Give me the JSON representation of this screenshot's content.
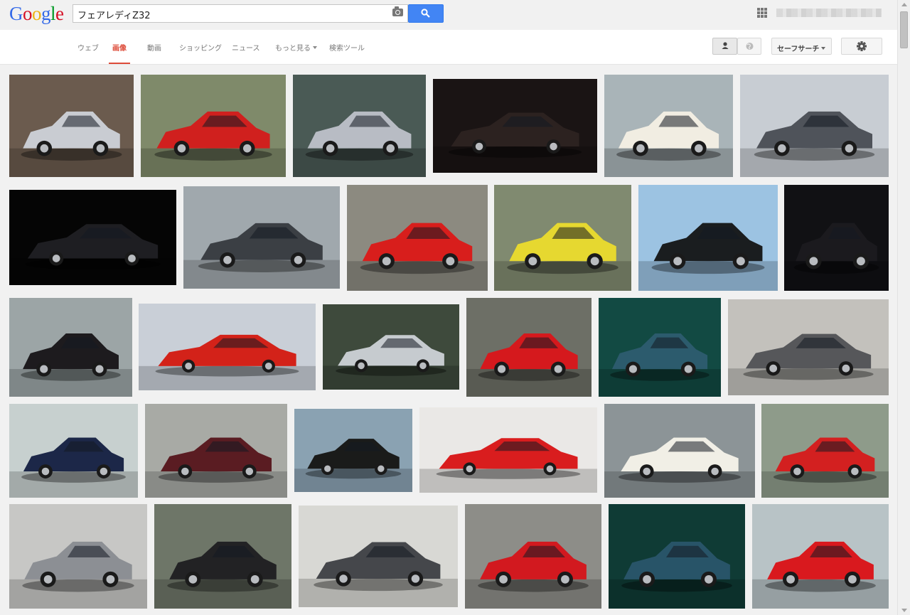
{
  "logo": [
    "G",
    "o",
    "o",
    "g",
    "l",
    "e"
  ],
  "search": {
    "query": "フェアレディZ32"
  },
  "nav": {
    "tabs": [
      {
        "label": "ウェブ",
        "selected": false
      },
      {
        "label": "画像",
        "selected": true
      },
      {
        "label": "動画",
        "selected": false
      },
      {
        "label": "ショッピング",
        "selected": false
      },
      {
        "label": "ニュース",
        "selected": false
      },
      {
        "label": "もっと見る",
        "selected": false,
        "dropdown": true
      },
      {
        "label": "検索ツール",
        "selected": false
      }
    ],
    "safe_search_label": "セーフサーチ"
  },
  "icons": {
    "search_button": "magnifier-icon",
    "camera": "camera-icon",
    "apps": "apps-grid-icon",
    "person": "person-icon",
    "globe": "globe-icon",
    "settings": "gear-icon"
  },
  "results": [
    {
      "bg": "#6b5b4e",
      "car": "#c9ccd2"
    },
    {
      "bg": "#7f8a6a",
      "car": "#d0201e"
    },
    {
      "bg": "#4a5a55",
      "car": "#b8bcc4"
    },
    {
      "bg": "#1a1414",
      "car": "#2c2220"
    },
    {
      "bg": "#a9b4b8",
      "car": "#f1ede2"
    },
    {
      "bg": "#c8cdd3",
      "car": "#4f535a"
    },
    {
      "bg": "#050505",
      "car": "#1e1e22"
    },
    {
      "bg": "#a0a8ad",
      "car": "#3b3f44"
    },
    {
      "bg": "#8c8a80",
      "car": "#d81e1c"
    },
    {
      "bg": "#808a70",
      "car": "#e6d830"
    },
    {
      "bg": "#9cc3e2",
      "car": "#1a1d1f"
    },
    {
      "bg": "#111114",
      "car": "#1b1a1e"
    },
    {
      "bg": "#9ca5a6",
      "car": "#1d1b1e"
    },
    {
      "bg": "#c9cfd7",
      "car": "#d32219"
    },
    {
      "bg": "#3e4a3c",
      "car": "#c6cbcf"
    },
    {
      "bg": "#6d6f66",
      "car": "#d5191d"
    },
    {
      "bg": "#124a43",
      "car": "#2c5b6d"
    },
    {
      "bg": "#c3c1bc",
      "car": "#56575a"
    },
    {
      "bg": "#c7d0cf",
      "car": "#1c2748"
    },
    {
      "bg": "#a8aaa5",
      "car": "#5a1c22"
    },
    {
      "bg": "#8aa2b2",
      "car": "#1a1b1a"
    },
    {
      "bg": "#eae8e6",
      "car": "#d91d1e"
    },
    {
      "bg": "#8c9497",
      "car": "#f1efe6"
    },
    {
      "bg": "#8e9b8a",
      "car": "#d32020"
    },
    {
      "bg": "#c7c7c5",
      "car": "#8c8f94"
    },
    {
      "bg": "#6e7668",
      "car": "#222224"
    },
    {
      "bg": "#d8d8d4",
      "car": "#45474b"
    },
    {
      "bg": "#8d8d88",
      "car": "#d2191f"
    },
    {
      "bg": "#0f3b35",
      "car": "#285468"
    },
    {
      "bg": "#b8c3c6",
      "car": "#d9191e"
    }
  ]
}
